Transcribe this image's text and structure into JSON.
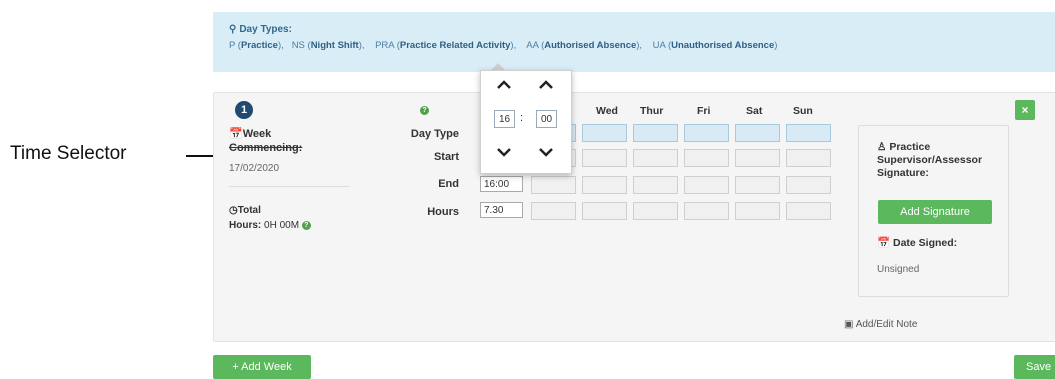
{
  "annotation": {
    "label": "Time Selector"
  },
  "banner": {
    "title": "Day Types:",
    "line": [
      {
        "code": "P (",
        "name": "Practice",
        "end": "),"
      },
      {
        "code": "NS (",
        "name": "Night Shift",
        "end": "),"
      },
      {
        "code": "PRA (",
        "name": "Practice Related Activity",
        "end": "),"
      },
      {
        "code": "AA (",
        "name": "Authorised Absence",
        "end": "),"
      },
      {
        "code": "UA (",
        "name": "Unauthorised Absence",
        "end": ")"
      }
    ]
  },
  "week": {
    "number": "1",
    "label_line1": "Week",
    "label_line2": "Commencing:",
    "date": "17/02/2020",
    "total_label": "Total",
    "hours_label": "Hours:",
    "hours_value": "0H 00M"
  },
  "grid": {
    "help": "?",
    "rows": [
      "Day Type",
      "Start",
      "End",
      "Hours"
    ],
    "days": [
      "Wed",
      "Thur",
      "Fri",
      "Sat",
      "Sun"
    ],
    "end_value": "16:00",
    "hours_value": "7.30"
  },
  "picker": {
    "hour": "16",
    "minute": "00",
    "separator": ":"
  },
  "signature": {
    "title": "Practice Supervisor/Assessor Signature:",
    "add_button": "Add Signature",
    "date_label": "Date Signed:",
    "status": "Unsigned"
  },
  "actions": {
    "close": "×",
    "note": "Add/Edit Note",
    "add_week": "Add Week",
    "save": "Save"
  },
  "colors": {
    "banner_bg": "#d9edf7",
    "green": "#5cb85c",
    "badge": "#1f4a72"
  }
}
